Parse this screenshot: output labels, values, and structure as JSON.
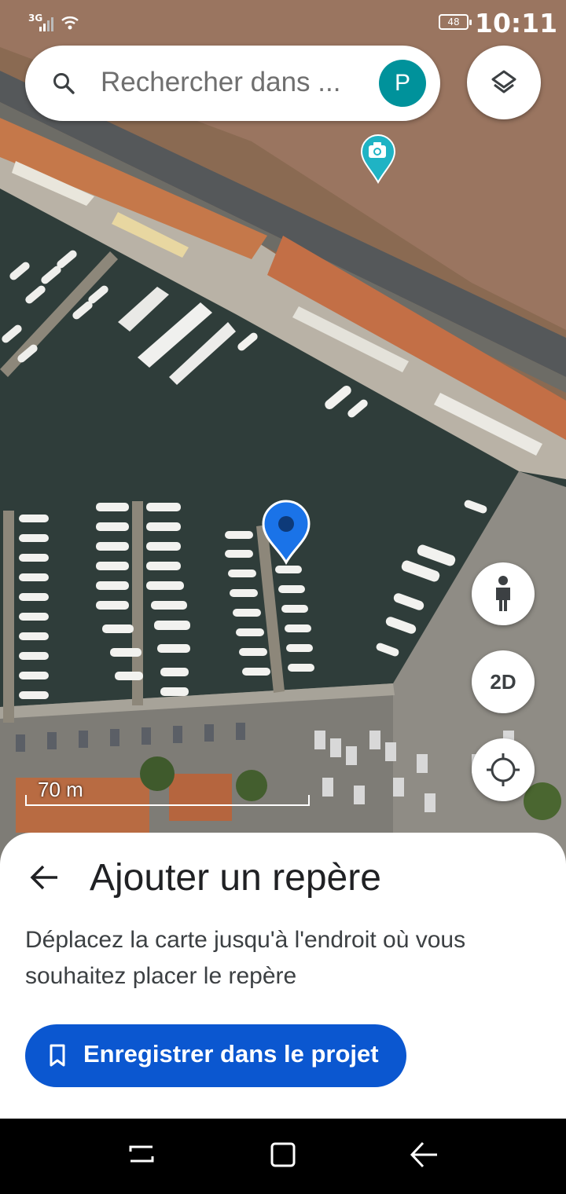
{
  "status_bar": {
    "network": "3G",
    "battery": "48",
    "time": "10:11"
  },
  "search": {
    "placeholder": "Rechercher dans ...",
    "avatar_initial": "P"
  },
  "map": {
    "scale_label": "70 m",
    "view_mode_label": "2D",
    "icons": [
      "layers-icon",
      "pegman-icon",
      "my-location-icon",
      "camera-pin-icon",
      "location-marker-icon"
    ]
  },
  "sheet": {
    "title": "Ajouter un repère",
    "description": "Déplacez la carte jusqu'à l'endroit où vous souhaitez placer le repère",
    "save_label": "Enregistrer dans le projet"
  },
  "colors": {
    "primary_button": "#0b57d0",
    "avatar": "#00929b",
    "marker": "#1a73e8",
    "photo_pin": "#1fb3c4"
  }
}
